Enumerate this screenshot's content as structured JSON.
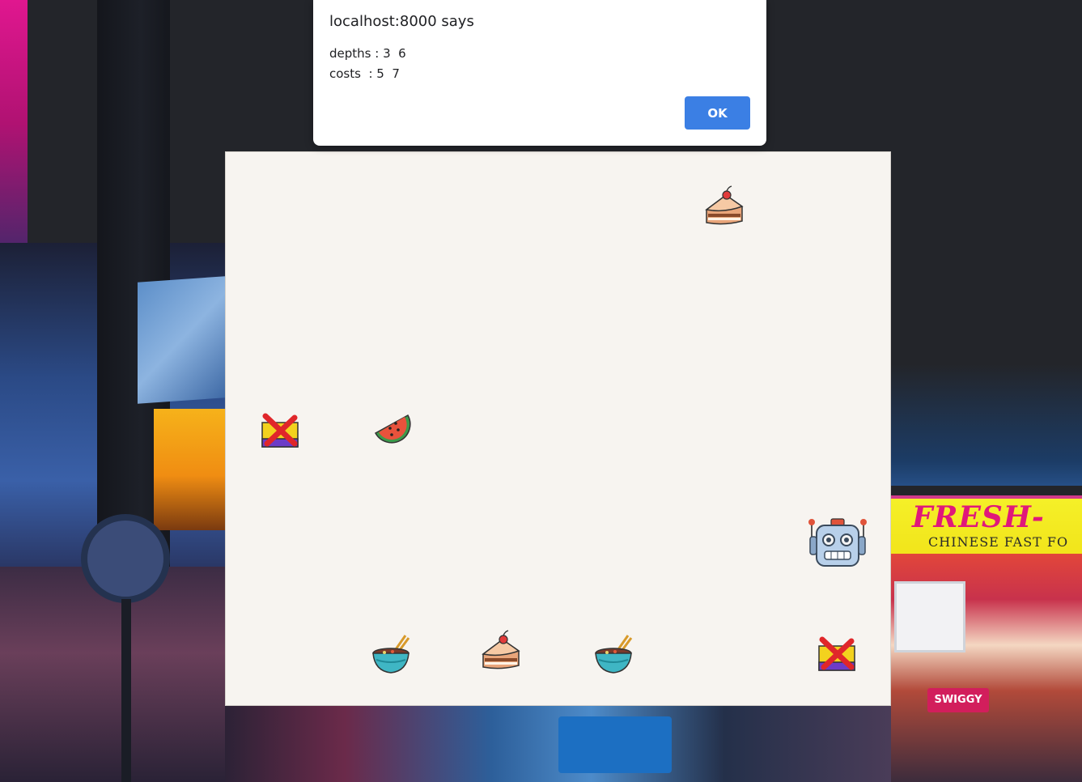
{
  "dialog": {
    "title": "localhost:8000 says",
    "message_lines": [
      "depths : 3  6",
      "costs  : 5  7"
    ],
    "ok_label": "OK",
    "accent_color": "#3b7fe4"
  },
  "background": {
    "banner_text": "FRESH-",
    "banner_subtext": "CHINESE FAST FO",
    "swiggy_text": "SWIGGY"
  },
  "board": {
    "background_color": "#f7f4f0",
    "sprites": [
      {
        "name": "cake-icon",
        "kind": "cake"
      },
      {
        "name": "crossed-out-box-icon",
        "kind": "crossed-box"
      },
      {
        "name": "watermelon-icon",
        "kind": "watermelon"
      },
      {
        "name": "robot-icon",
        "kind": "robot"
      },
      {
        "name": "noodle-bowl-icon",
        "kind": "bowl"
      },
      {
        "name": "cake-icon",
        "kind": "cake"
      },
      {
        "name": "noodle-bowl-icon",
        "kind": "bowl"
      },
      {
        "name": "crossed-out-box-icon",
        "kind": "crossed-box"
      }
    ]
  }
}
